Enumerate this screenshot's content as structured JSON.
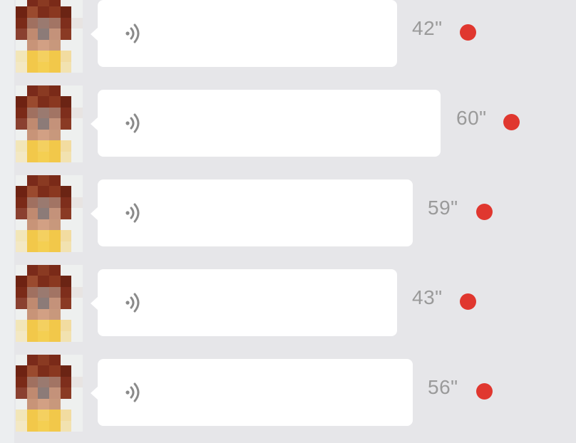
{
  "chat": {
    "icon_name": "voice-wave-icon",
    "unread_color": "#e0372f",
    "messages": [
      {
        "duration": "42\"",
        "unread": true
      },
      {
        "duration": "60\"",
        "unread": true
      },
      {
        "duration": "59\"",
        "unread": true
      },
      {
        "duration": "43\"",
        "unread": true
      },
      {
        "duration": "56\"",
        "unread": true
      }
    ]
  }
}
